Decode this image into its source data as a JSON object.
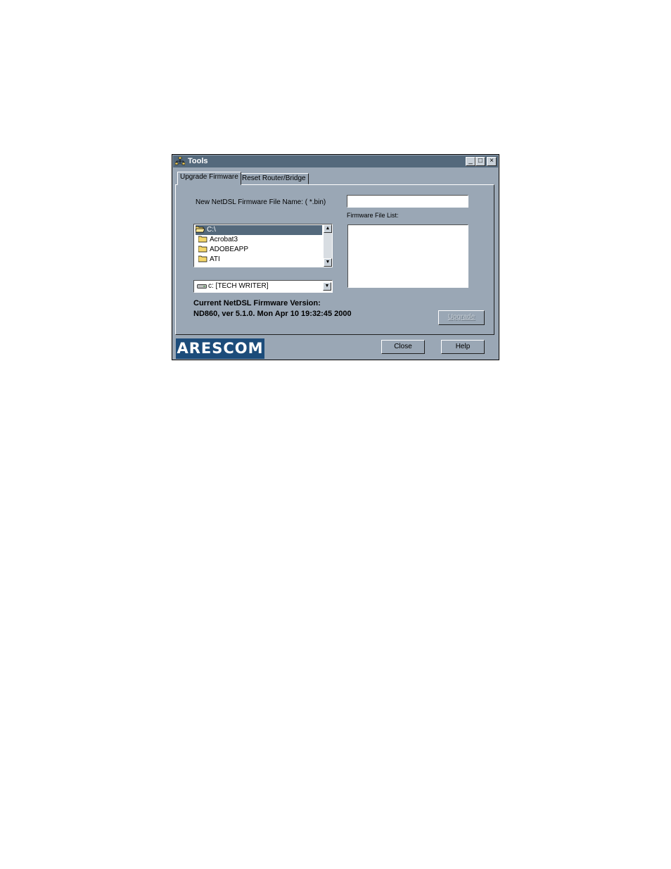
{
  "window": {
    "title": "Tools",
    "controls": [
      "_",
      "□",
      "×"
    ]
  },
  "tabs": [
    {
      "label": "Upgrade Firmware",
      "active": true
    },
    {
      "label": "Reset Router/Bridge",
      "active": false
    }
  ],
  "upgrade": {
    "file_name_label": "New NetDSL Firmware File Name: ( *.bin)",
    "file_name_value": "",
    "file_list_label": "Firmware File List:",
    "directories": [
      {
        "name": "C:\\",
        "selected": true,
        "icon": "open-folder-icon"
      },
      {
        "name": "Acrobat3",
        "selected": false,
        "icon": "folder-icon"
      },
      {
        "name": "ADOBEAPP",
        "selected": false,
        "icon": "folder-icon"
      },
      {
        "name": "ATI",
        "selected": false,
        "icon": "folder-icon"
      }
    ],
    "drive_selected": "c: [TECH WRITER]",
    "version_heading": "Current NetDSL Firmware Version:",
    "version_value": "ND860, ver 5.1.0.  Mon Apr 10 19:32:45 2000",
    "upgrade_button": "Upgrade"
  },
  "footer": {
    "logo_text": "ARESCOM",
    "close_button": "Close",
    "help_button": "Help"
  },
  "colors": {
    "window_bg": "#9aa7b5",
    "titlebar": "#54697c",
    "selection": "#54697c",
    "logo_bg": "#1c4c7a"
  }
}
